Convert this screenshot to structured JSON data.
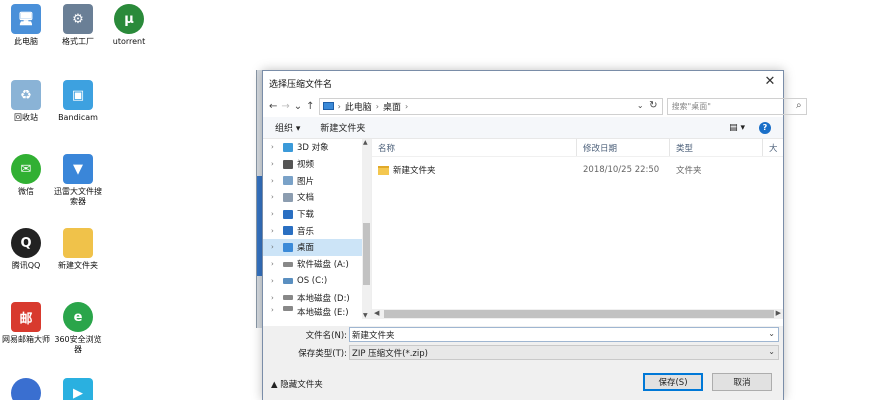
{
  "desktop": {
    "icons": [
      {
        "label": "此电脑",
        "color": "#4a90d9"
      },
      {
        "label": "格式工厂",
        "color": "#6a7f96"
      },
      {
        "label": "utorrent",
        "color": "#2a8a3a"
      },
      {
        "label": "回收站",
        "color": "#8ab3d6"
      },
      {
        "label": "Bandicam",
        "color": "#3da1e0"
      },
      {
        "label": "微信",
        "color": "#31b033"
      },
      {
        "label": "迅雷大文件搜索器",
        "color": "#3a86d9"
      },
      {
        "label": "腾讯QQ",
        "color": "#222222"
      },
      {
        "label": "新建文件夹",
        "color": "#f0c24a"
      },
      {
        "label": "网易邮箱大师",
        "color": "#d83a2e"
      },
      {
        "label": "360安全浏览器",
        "color": "#2aa54a"
      }
    ]
  },
  "dialog": {
    "title": "选择压缩文件名",
    "close": "✕",
    "nav": {
      "back": "←",
      "forward": "→",
      "recent": "⌄",
      "up": "↑"
    },
    "breadcrumb": [
      "此电脑",
      "桌面"
    ],
    "search_placeholder": "搜索\"桌面\"",
    "toolbar": {
      "organize": "组织 ▾",
      "new_folder": "新建文件夹",
      "view": "▤ ▾",
      "help": "?"
    },
    "tree": [
      {
        "label": "3D 对象",
        "color": "#3b9ad9",
        "selected": false
      },
      {
        "label": "视频",
        "color": "#555555",
        "selected": false
      },
      {
        "label": "图片",
        "color": "#7aa2c8",
        "selected": false
      },
      {
        "label": "文档",
        "color": "#8c9db0",
        "selected": false
      },
      {
        "label": "下载",
        "color": "#2a6fc2",
        "selected": false
      },
      {
        "label": "音乐",
        "color": "#2a6fc2",
        "selected": false
      },
      {
        "label": "桌面",
        "color": "#3b8ad8",
        "selected": true
      },
      {
        "label": "软件磁盘 (A:)",
        "color": "#888888",
        "selected": false
      },
      {
        "label": "OS (C:)",
        "color": "#5a8fc0",
        "selected": false
      },
      {
        "label": "本地磁盘 (D:)",
        "color": "#888888",
        "selected": false
      },
      {
        "label": "本地磁盘 (E:)",
        "color": "#888888",
        "selected": false
      }
    ],
    "columns": {
      "name": "名称",
      "modified": "修改日期",
      "type": "类型",
      "size": "大"
    },
    "files": [
      {
        "name": "新建文件夹",
        "modified": "2018/10/25 22:50",
        "type": "文件夹"
      }
    ],
    "form": {
      "filename_label": "文件名(N):",
      "filename_value": "新建文件夹",
      "filetype_label": "保存类型(T):",
      "filetype_value": "ZIP 压缩文件(*.zip)",
      "hide_folders": "▲ 隐藏文件夹",
      "save": "保存(S)",
      "cancel": "取消"
    }
  }
}
